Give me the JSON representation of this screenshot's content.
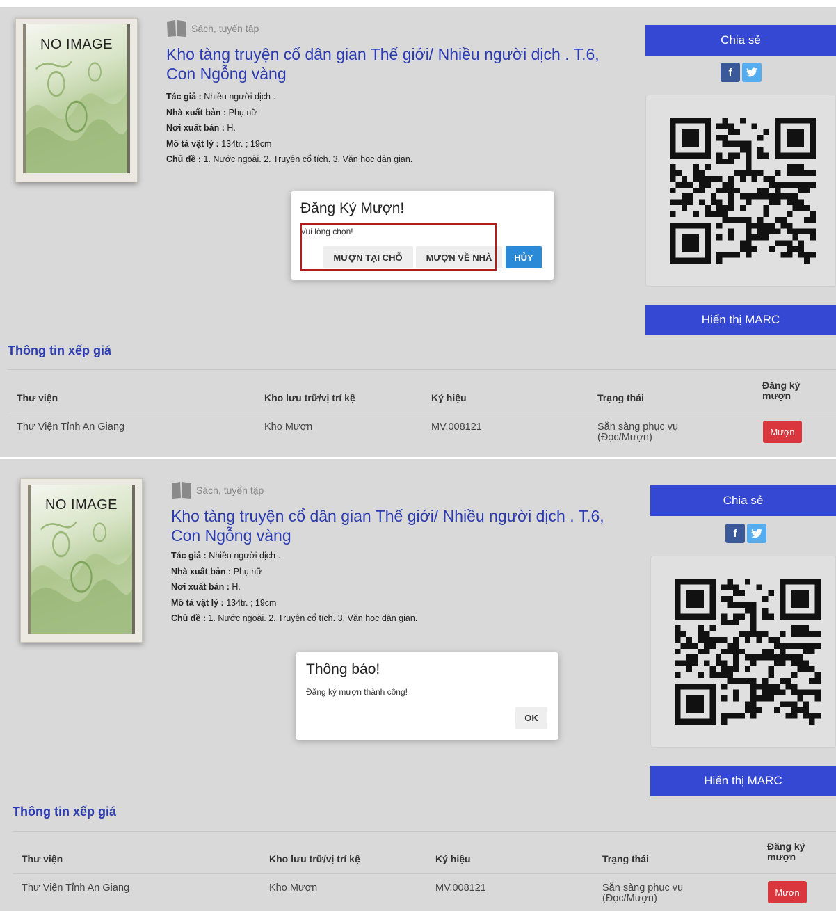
{
  "book": {
    "cover_text": "NO IMAGE",
    "type": "Sách, tuyển tập",
    "title": "Kho tàng truyện cổ dân gian Thế giới/ Nhiều người dịch . T.6, Con Ngỗng vàng",
    "meta": [
      {
        "label": "Tác giả :",
        "value": "Nhiều người dịch ."
      },
      {
        "label": "Nhà xuất bản :",
        "value": "Phụ nữ"
      },
      {
        "label": "Nơi xuất bản :",
        "value": "H."
      },
      {
        "label": "Mô tả vật lý :",
        "value": "134tr. ; 19cm"
      },
      {
        "label": "Chủ đề :",
        "value": "1. Nước ngoài. 2. Truyện cổ tích. 3. Văn học dân gian."
      }
    ]
  },
  "sidebar": {
    "share_label": "Chia sẻ",
    "facebook_glyph": "f",
    "twitter_glyph": "t",
    "marc_label": "Hiển thị MARC",
    "accent": "#3548d4"
  },
  "holdings": {
    "section_title": "Thông tin xếp giá",
    "headers": {
      "library": "Thư viện",
      "location": "Kho lưu trữ/vị trí kệ",
      "call_number": "Ký hiệu",
      "status": "Trạng thái",
      "borrow_line1": "Đăng ký",
      "borrow_line2": "mượn"
    },
    "row": {
      "library": "Thư Viện Tỉnh An Giang",
      "location": "Kho Mượn",
      "call_number": "MV.008121",
      "status_line1": "Sẵn sàng phục vụ",
      "status_line2": "(Đọc/Mượn)",
      "borrow_button": "Mượn"
    }
  },
  "dialog_register": {
    "title": "Đăng Ký Mượn!",
    "message": "Vui lòng chọn!",
    "btn_onsite": "MƯỢN TẠI CHỖ",
    "btn_home": "MƯỢN VỀ NHÀ",
    "btn_cancel": "HỦY"
  },
  "dialog_notice": {
    "title": "Thông báo!",
    "message": "Đăng ký mượn thành công!",
    "btn_ok": "OK"
  }
}
